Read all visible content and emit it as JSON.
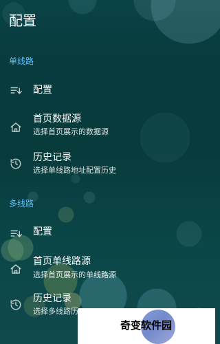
{
  "header": {
    "title": "配置"
  },
  "sections": {
    "single_line": "单线路",
    "multi_line": "多线路"
  },
  "rows": {
    "single_config": {
      "title": "配置"
    },
    "home_data_source": {
      "title": "首页数据源",
      "subtitle": "选择首页展示的数据源"
    },
    "history_record_single": {
      "title": "历史记录",
      "subtitle": "选择单线路地址配置历史"
    },
    "multi_config": {
      "title": "配置"
    },
    "home_single_route_source": {
      "title": "首页单线路源",
      "subtitle": "选择首页展示的单线路源"
    },
    "history_record_multi": {
      "title": "历史记录",
      "subtitle": "选择多线路历"
    }
  },
  "icons": {
    "config": "sort-lines-icon",
    "home": "home-icon",
    "history": "history-icon"
  },
  "watermark": {
    "text": "奇变软件园"
  },
  "colors": {
    "section_header": "#5bc0ff",
    "text_primary": "#ffffff",
    "text_secondary": "rgba(255,255,255,0.85)"
  }
}
